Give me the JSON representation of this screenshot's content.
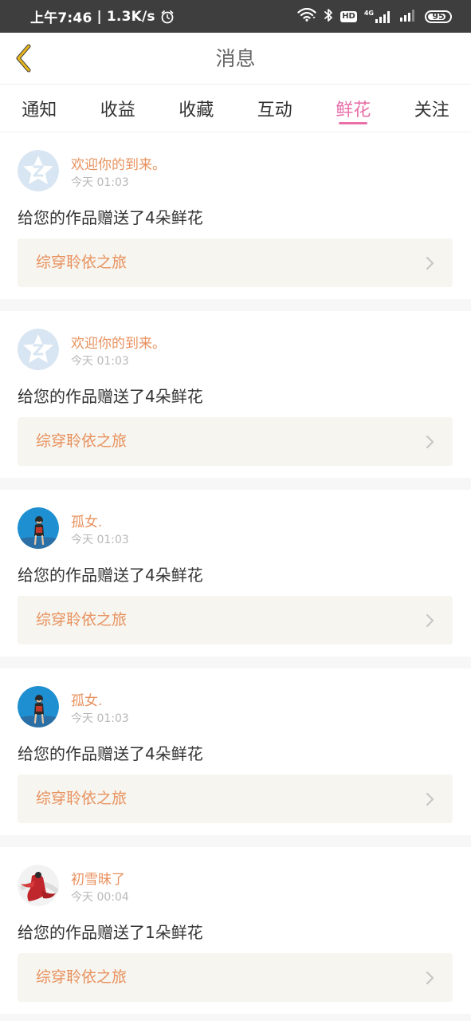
{
  "status_bar": {
    "time": "上午7:46",
    "net_speed": "1.3K/s",
    "network": "4G",
    "battery": "95",
    "icons": [
      "alarm-icon",
      "wifi-icon",
      "bluetooth-icon",
      "hd-icon",
      "signal-icon",
      "battery-icon"
    ]
  },
  "header": {
    "title": "消息",
    "back_icon": "chevron-left-icon",
    "back_color": "#e6b61c"
  },
  "tabs": [
    {
      "label": "通知",
      "active": false
    },
    {
      "label": "收益",
      "active": false
    },
    {
      "label": "收藏",
      "active": false
    },
    {
      "label": "互动",
      "active": false
    },
    {
      "label": "鲜花",
      "active": true
    },
    {
      "label": "关注",
      "active": false
    }
  ],
  "colors": {
    "accent_pink": "#e86fa8",
    "accent_orange": "#e8915e",
    "card_link_bg": "#f6f5ef"
  },
  "messages": [
    {
      "user": "欢迎你的到来。",
      "time": "今天 01:03",
      "text": "给您的作品赠送了4朵鲜花",
      "work": "综穿聆依之旅",
      "avatar": "default-star-avatar"
    },
    {
      "user": "欢迎你的到来。",
      "time": "今天 01:03",
      "text": "给您的作品赠送了4朵鲜花",
      "work": "综穿聆依之旅",
      "avatar": "default-star-avatar"
    },
    {
      "user": "孤女.",
      "time": "今天 01:03",
      "text": "给您的作品赠送了4朵鲜花",
      "work": "综穿聆依之旅",
      "avatar": "girl-photo-avatar"
    },
    {
      "user": "孤女.",
      "time": "今天 01:03",
      "text": "给您的作品赠送了4朵鲜花",
      "work": "综穿聆依之旅",
      "avatar": "girl-photo-avatar"
    },
    {
      "user": "初雪昧了",
      "time": "今天 00:04",
      "text": "给您的作品赠送了1朵鲜花",
      "work": "综穿聆依之旅",
      "avatar": "red-dress-avatar"
    }
  ]
}
